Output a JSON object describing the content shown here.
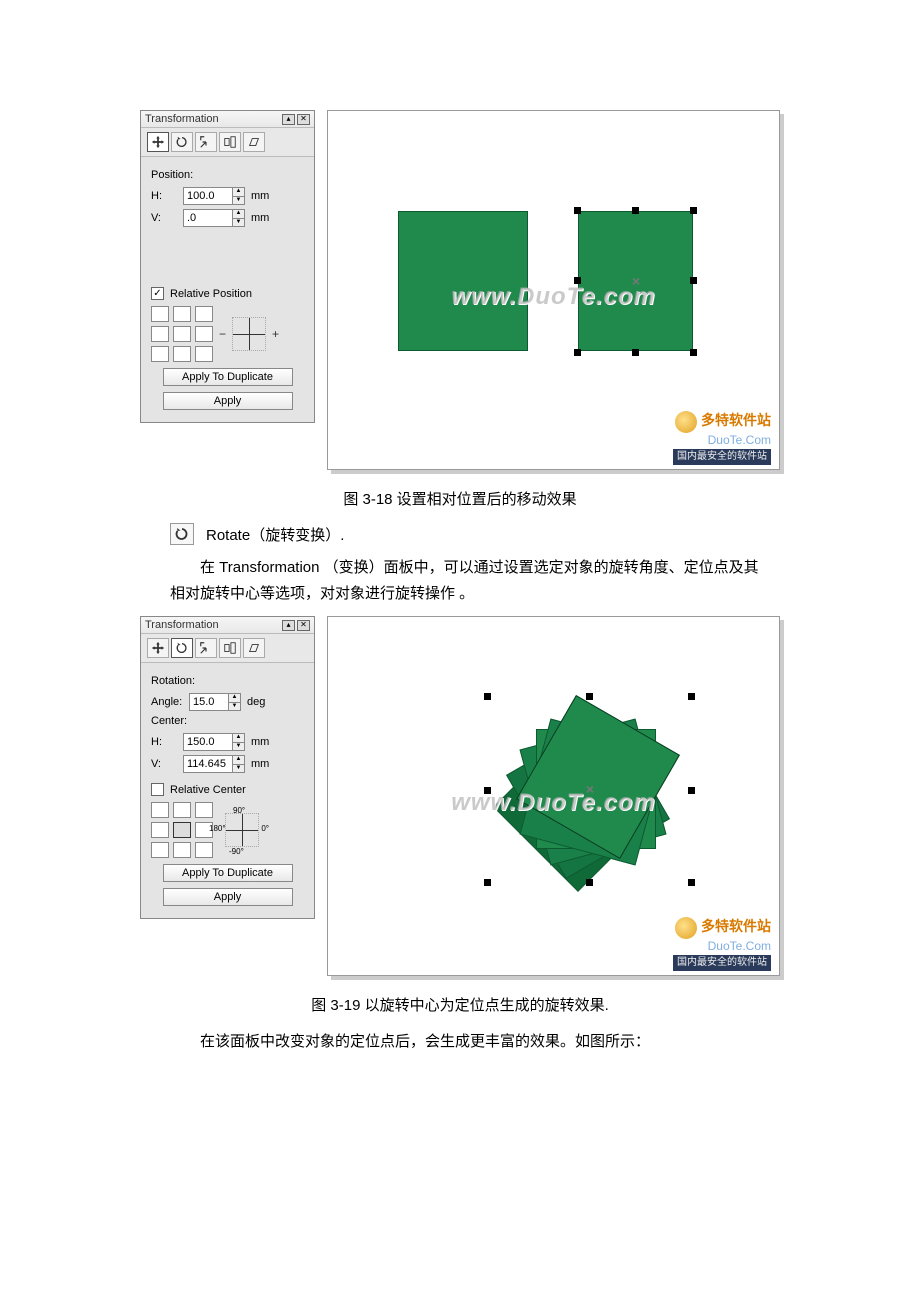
{
  "panel1": {
    "title": "Transformation",
    "section": "Position:",
    "h_label": "H:",
    "h_value": "100.0",
    "v_label": "V:",
    "v_value": ".0",
    "unit": "mm",
    "relative_label": "Relative Position",
    "btn_dup": "Apply To Duplicate",
    "btn_apply": "Apply"
  },
  "panel2": {
    "title": "Transformation",
    "section": "Rotation:",
    "angle_label": "Angle:",
    "angle_value": "15.0",
    "angle_unit": "deg",
    "center_label": "Center:",
    "h_label": "H:",
    "h_value": "150.0",
    "v_label": "V:",
    "v_value": "114.645",
    "unit": "mm",
    "relative_label": "Relative Center",
    "axis": {
      "top": "90°",
      "right": "0°",
      "bottom": "-90°",
      "left": "180°"
    },
    "btn_dup": "Apply To Duplicate",
    "btn_apply": "Apply"
  },
  "captions": {
    "fig1": "图  3-18 设置相对位置后的移动效果",
    "fig2": "图  3-19 以旋转中心为定位点生成的旋转效果."
  },
  "sections": {
    "rotate_head": "Rotate（旋转变换）.",
    "para1": "在 Transformation （变换）面板中，可以通过设置选定对象的旋转角度、定位点及其相对旋转中心等选项，对对象进行旋转操作 。",
    "para2": "在该面板中改变对象的定位点后，会生成更丰富的效果。如图所示："
  },
  "watermark": "www.DuoTe.com",
  "brand": {
    "cn": "多特软件站",
    "en": "DuoTe.Com",
    "bar": "国内最安全的软件站"
  }
}
